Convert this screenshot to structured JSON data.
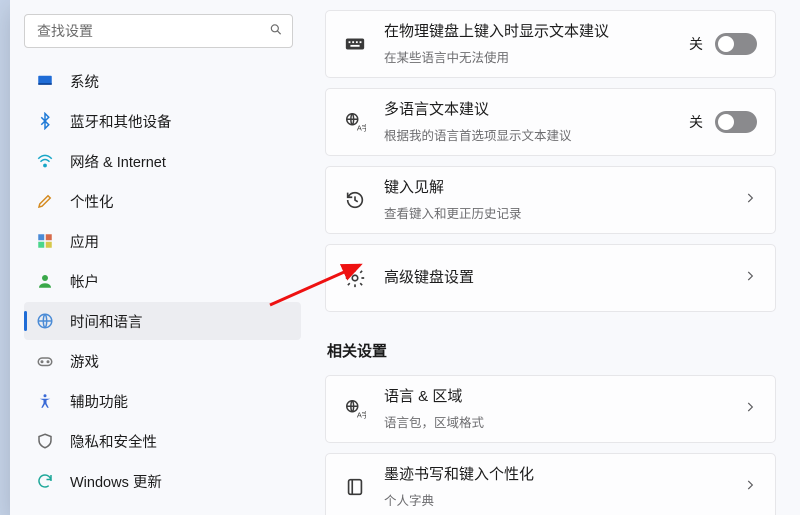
{
  "search": {
    "placeholder": "查找设置"
  },
  "sidebar": {
    "items": [
      {
        "label": "系统"
      },
      {
        "label": "蓝牙和其他设备"
      },
      {
        "label": "网络 & Internet"
      },
      {
        "label": "个性化"
      },
      {
        "label": "应用"
      },
      {
        "label": "帐户"
      },
      {
        "label": "时间和语言"
      },
      {
        "label": "游戏"
      },
      {
        "label": "辅助功能"
      },
      {
        "label": "隐私和安全性"
      },
      {
        "label": "Windows 更新"
      }
    ]
  },
  "main": {
    "cards": [
      {
        "title": "在物理键盘上键入时显示文本建议",
        "sub": "在某些语言中无法使用",
        "state": "关"
      },
      {
        "title": "多语言文本建议",
        "sub": "根据我的语言首选项显示文本建议",
        "state": "关"
      },
      {
        "title": "键入见解",
        "sub": "查看键入和更正历史记录"
      },
      {
        "title": "高级键盘设置"
      }
    ],
    "related_heading": "相关设置",
    "related": [
      {
        "title": "语言 & 区域",
        "sub": "语言包，区域格式"
      },
      {
        "title": "墨迹书写和键入个性化",
        "sub": "个人字典"
      }
    ]
  }
}
